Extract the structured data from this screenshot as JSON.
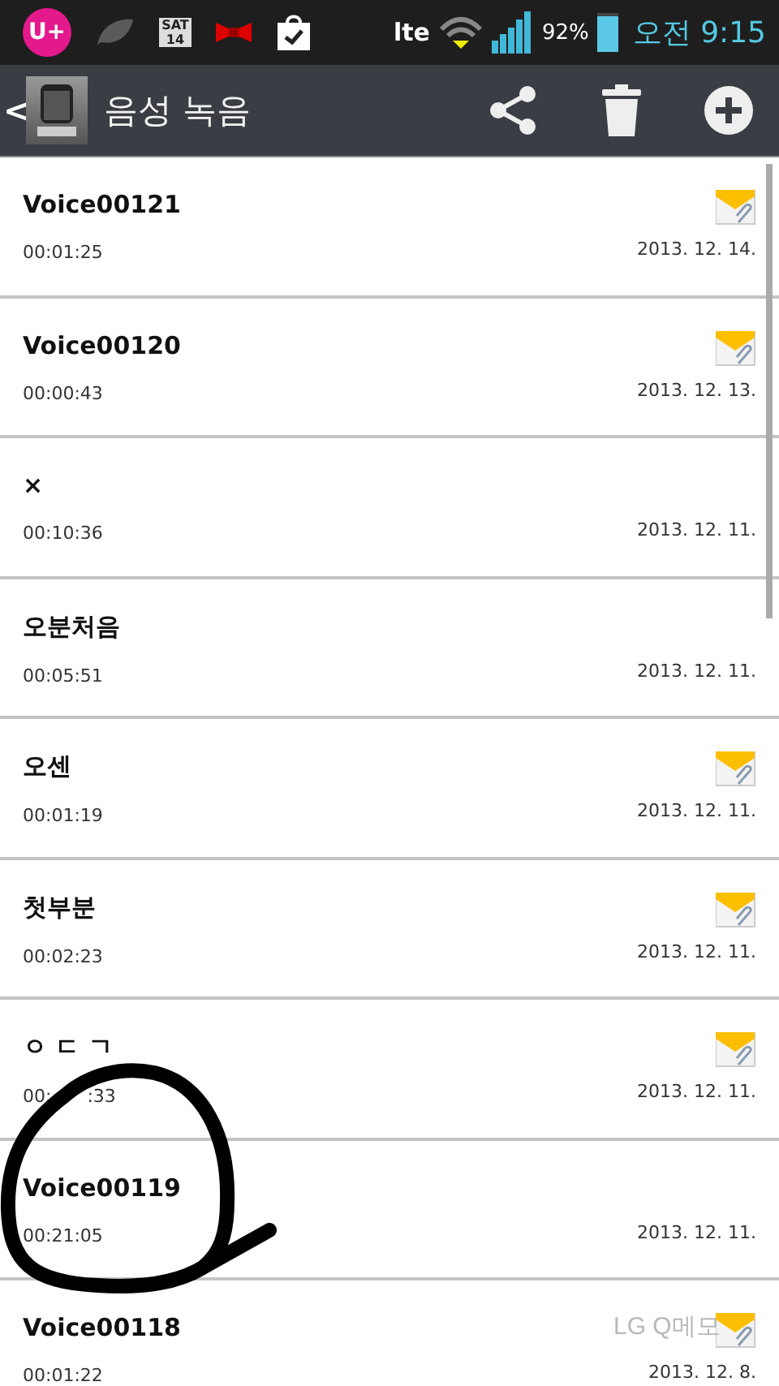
{
  "status_bar": {
    "carrier": "U+",
    "calendar_day": "SAT",
    "calendar_date": "14",
    "network": "lte",
    "battery_percent": "92%",
    "time": "오전 9:15"
  },
  "action_bar": {
    "back": "<",
    "title": "음성 녹음"
  },
  "recordings": [
    {
      "name": "Voice00121",
      "duration_parts": [
        "00:01:25"
      ],
      "date": "2013. 12. 14.",
      "attached": true
    },
    {
      "name": "Voice00120",
      "duration_parts": [
        "00:00:43"
      ],
      "date": "2013. 12. 13.",
      "attached": true
    },
    {
      "name": "×",
      "duration_parts": [
        "00:10:36"
      ],
      "date": "2013. 12. 11.",
      "attached": false
    },
    {
      "name": "오분처음",
      "duration_parts": [
        "00:05:51"
      ],
      "date": "2013. 12. 11.",
      "attached": false
    },
    {
      "name": "오센",
      "duration_parts": [
        "00:01:19"
      ],
      "date": "2013. 12. 11.",
      "attached": true
    },
    {
      "name": "첫부분",
      "duration_parts": [
        "00:02:23"
      ],
      "date": "2013. 12. 11.",
      "attached": true
    },
    {
      "name": "ㅇ ㄷ ㄱ",
      "duration_parts": [
        "00:",
        ":33"
      ],
      "date": "2013. 12. 11.",
      "attached": true
    },
    {
      "name": "Voice00119",
      "duration_parts": [
        "00:21:05"
      ],
      "date": "2013. 12. 11.",
      "attached": false
    },
    {
      "name": "Voice00118",
      "duration_parts": [
        "00:01:22"
      ],
      "date": "2013. 12. 8.",
      "attached": true
    }
  ],
  "screenshot_label": "LG Q메모"
}
